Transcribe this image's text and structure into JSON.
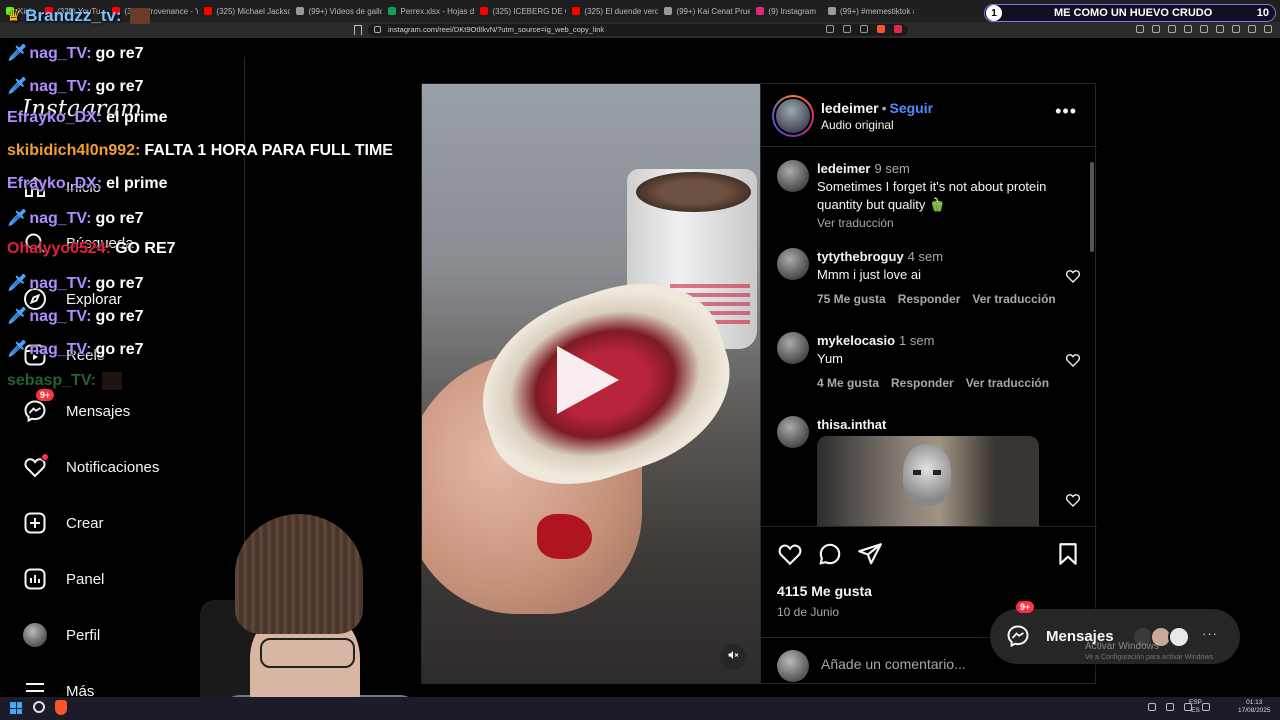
{
  "browser": {
    "tabs": [
      {
        "label": "Kick",
        "color": "#53fc18"
      },
      {
        "label": "(325) YouTu",
        "color": "#ff0000"
      },
      {
        "label": "(325) Provenance - YouT",
        "color": "#ff0000"
      },
      {
        "label": "(325) Michael Jackson -",
        "color": "#ff0000"
      },
      {
        "label": "(99+) Videos de gallos G",
        "color": "#999999"
      },
      {
        "label": "Perrex.xlsx - Hojas de cál",
        "color": "#0f9d58"
      },
      {
        "label": "(325) ICEBERG DE CASO",
        "color": "#ff0000"
      },
      {
        "label": "(325) El duende verde le",
        "color": "#ff0000"
      },
      {
        "label": "(99+) Kai Cenat Prueba",
        "color": "#999999"
      },
      {
        "label": "(9) Instagram",
        "color": "#dd2a7b"
      },
      {
        "label": "(99+) #memestiktok #",
        "color": "#999999"
      }
    ],
    "url": "instagram.com/reel/DKt9OtlIkvN/?utm_source=ig_web_copy_link"
  },
  "instagram": {
    "logo": "Instagram",
    "sidebar": [
      {
        "label": "Inicio",
        "icon": "home-icon"
      },
      {
        "label": "Búsqueda",
        "icon": "search-icon"
      },
      {
        "label": "Explorar",
        "icon": "compass-icon"
      },
      {
        "label": "Reels",
        "icon": "reels-icon"
      },
      {
        "label": "Mensajes",
        "icon": "messenger-icon",
        "badge": "9+"
      },
      {
        "label": "Notificaciones",
        "icon": "heart-icon"
      },
      {
        "label": "Crear",
        "icon": "plus-square-icon"
      },
      {
        "label": "Panel",
        "icon": "chart-icon"
      },
      {
        "label": "Perfil",
        "icon": "avatar"
      },
      {
        "label": "Más",
        "icon": "menu-icon"
      }
    ],
    "post": {
      "username": "ledeimer",
      "follow": "Seguir",
      "audio": "Audio original",
      "comments": [
        {
          "user": "ledeimer",
          "time": "9 sem",
          "text": "Sometimes I forget it's not about protein quantity but quality 🫑",
          "translate": "Ver traducción"
        },
        {
          "user": "tytythebroguy",
          "time": "4 sem",
          "text": "Mmm i just love ai",
          "likes": "75 Me gusta",
          "reply": "Responder",
          "translate": "Ver traducción"
        },
        {
          "user": "mykelocasio",
          "time": "1 sem",
          "text": "Yum",
          "likes": "4 Me gusta",
          "reply": "Responder",
          "translate": "Ver traducción"
        },
        {
          "user": "thisa.inthat",
          "time": "",
          "text": ""
        }
      ],
      "likes": "4115 Me gusta",
      "date": "10 de Junio",
      "comment_placeholder": "Añade un comentario..."
    },
    "messages_pill": {
      "label": "Mensajes",
      "badge": "9+"
    }
  },
  "watermark": {
    "line1": "Activar Windows",
    "line2": "Ve a Configuración para activar Windows."
  },
  "stream": {
    "chat_header": "Brandzz_tv:",
    "chat": [
      {
        "user": "nag_TV:",
        "msg": "go re7",
        "color": "#b18cff",
        "sword": true
      },
      {
        "user": "nag_TV:",
        "msg": "go re7",
        "color": "#b18cff",
        "sword": true
      },
      {
        "user": "Efrayko_DX:",
        "msg": "el prime",
        "color": "#b18cff",
        "sword": false
      },
      {
        "user": "skibidich4l0n992:",
        "msg": "FALTA 1 HORA PARA FULL TIME",
        "color": "#f0a030",
        "sword": false
      },
      {
        "user": "Efrayko_DX:",
        "msg": "el prime",
        "color": "#b18cff",
        "sword": false
      },
      {
        "user": "nag_TV:",
        "msg": "go re7",
        "color": "#b18cff",
        "sword": true
      },
      {
        "user": "Ohaiyyo0524:",
        "msg": "GO RE7",
        "color": "#e02040",
        "sword": false
      },
      {
        "user": "nag_TV:",
        "msg": "go re7",
        "color": "#b18cff",
        "sword": true
      },
      {
        "user": "nag_TV:",
        "msg": "go re7",
        "color": "#b18cff",
        "sword": true
      },
      {
        "user": "nag_TV:",
        "msg": "go re7",
        "color": "#b18cff",
        "sword": true
      },
      {
        "user": "sebasp_TV:",
        "msg": "",
        "color": "#40b060",
        "sword": false
      }
    ],
    "poll": {
      "number": "1",
      "text": "ME COMO UN HUEVO CRUDO",
      "count": "10"
    }
  },
  "taskbar": {
    "lang_line1": "ESP",
    "lang_line2": "ES",
    "time": "01:13",
    "date": "17/08/2025"
  }
}
